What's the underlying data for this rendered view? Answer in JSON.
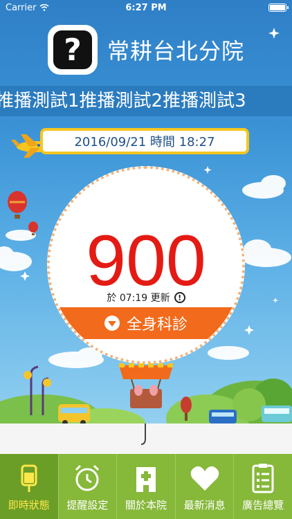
{
  "status_bar": {
    "carrier": "Carrier",
    "time": "6:27 PM"
  },
  "header": {
    "title": "常耕台北分院",
    "help_glyph": "?"
  },
  "ticker": {
    "text": "推播測試1推播測試2推播測試3"
  },
  "date_time": "2016/09/21 時間 18:27",
  "queue": {
    "number": "900",
    "updated_text": "於 07:19 更新",
    "info_glyph": "!",
    "department": "全身科診"
  },
  "tabs": [
    {
      "label": "即時狀態",
      "icon": "iv-bag-icon",
      "active": true
    },
    {
      "label": "提醒設定",
      "icon": "alarm-clock-icon",
      "active": false
    },
    {
      "label": "關於本院",
      "icon": "hospital-icon",
      "active": false
    },
    {
      "label": "最新消息",
      "icon": "heart-icon",
      "active": false
    },
    {
      "label": "廣告總覽",
      "icon": "checklist-icon",
      "active": false
    }
  ],
  "colors": {
    "accent_orange": "#f26a1b",
    "number_red": "#e31b14",
    "tab_green": "#86b83a",
    "ticker_blue": "#2b7bbf"
  }
}
